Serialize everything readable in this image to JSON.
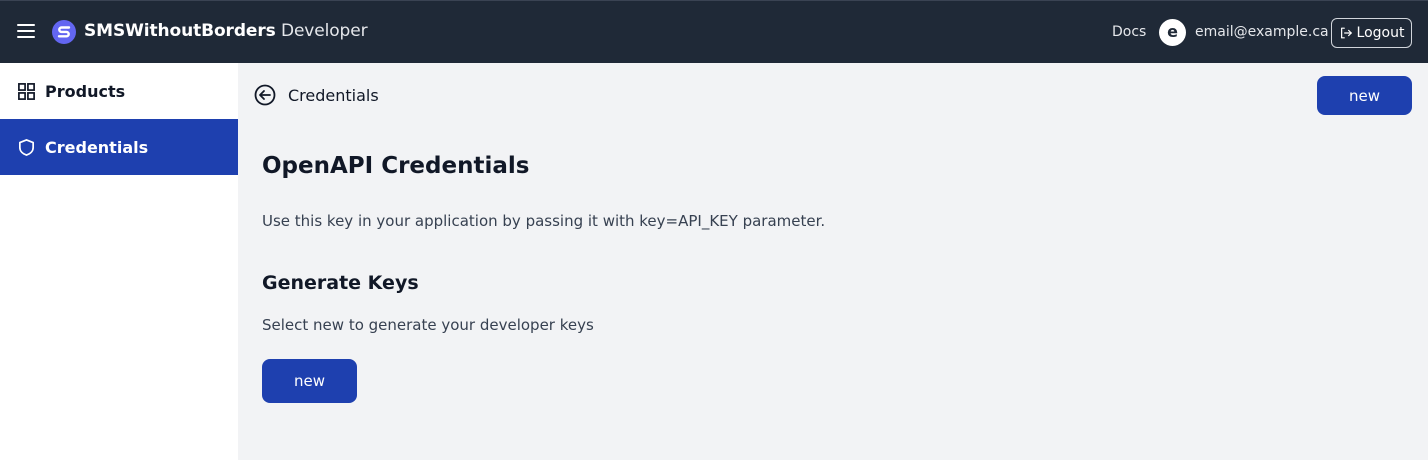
{
  "header": {
    "brand_bold": "SMSWithoutBorders",
    "brand_suffix": " Developer",
    "docs_label": "Docs",
    "avatar_letter": "e",
    "email": "email@example.ca",
    "logout_label": "Logout",
    "icons": [
      "hamburger-icon",
      "logo-icon",
      "logout-icon"
    ]
  },
  "sidebar": {
    "items": [
      {
        "label": "Products",
        "icon": "grid-icon",
        "active": false
      },
      {
        "label": "Credentials",
        "icon": "shield-icon",
        "active": true
      }
    ]
  },
  "main": {
    "breadcrumb": "Credentials",
    "top_button_label": "new",
    "title": "OpenAPI Credentials",
    "description": "Use this key in your application by passing it with key=API_KEY parameter.",
    "section_title": "Generate Keys",
    "section_text": "Select new to generate your developer keys",
    "body_button_label": "new"
  },
  "colors": {
    "header_bg": "#1f2937",
    "accent": "#1e40af",
    "page_bg": "#f2f3f5",
    "sidebar_bg": "#ffffff"
  }
}
